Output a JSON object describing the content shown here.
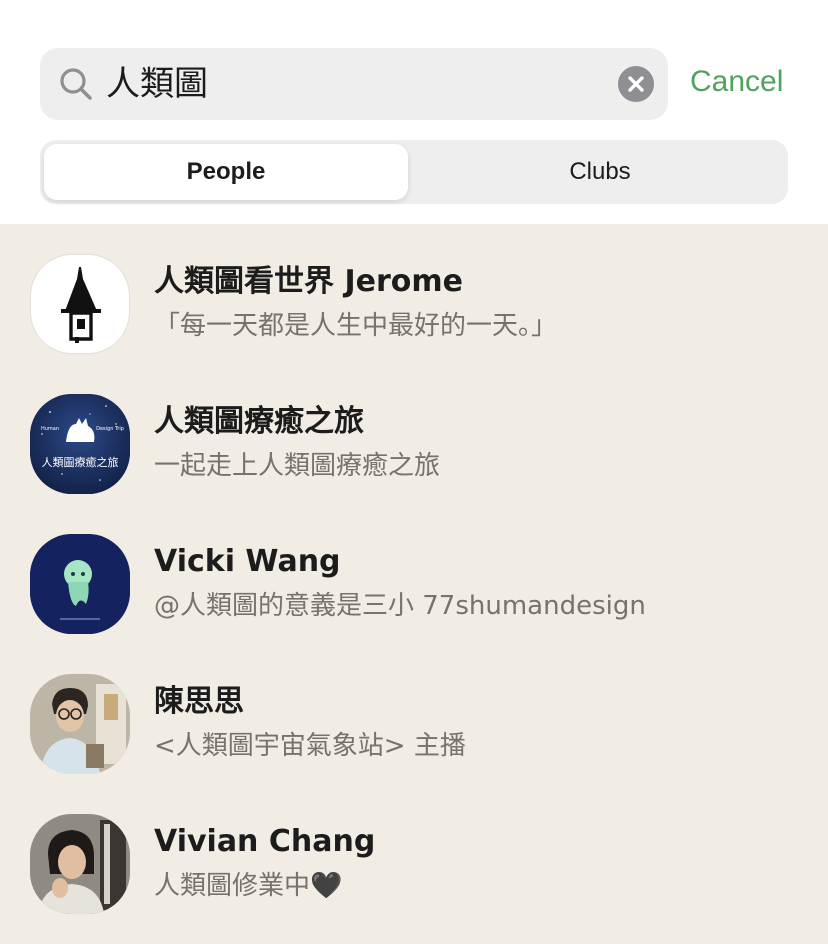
{
  "search": {
    "query": "人類圖",
    "cancel_label": "Cancel"
  },
  "tabs": [
    {
      "label": "People",
      "selected": true
    },
    {
      "label": "Clubs",
      "selected": false
    }
  ],
  "results": [
    {
      "name": "人類圖看世界 Jerome",
      "subtitle": "「每一天都是人生中最好的一天。」"
    },
    {
      "name": "人類圖療癒之旅",
      "subtitle": "一起走上人類圖療癒之旅"
    },
    {
      "name": "Vicki Wang",
      "subtitle": "@人類圖的意義是三小 77shumandesign"
    },
    {
      "name": "陳思思",
      "subtitle": "<人類圖宇宙氣象站> 主播"
    },
    {
      "name": "Vivian Chang",
      "subtitle": "人類圖修業中🖤"
    }
  ],
  "avatar_texts": {
    "healing_art": "人類圖療癒之旅",
    "healing_small_left": "Human",
    "healing_small_right": "Design Trip"
  },
  "colors": {
    "accent": "#4fa35e",
    "list_background": "#f1ede4",
    "subtitle": "#77726c"
  }
}
